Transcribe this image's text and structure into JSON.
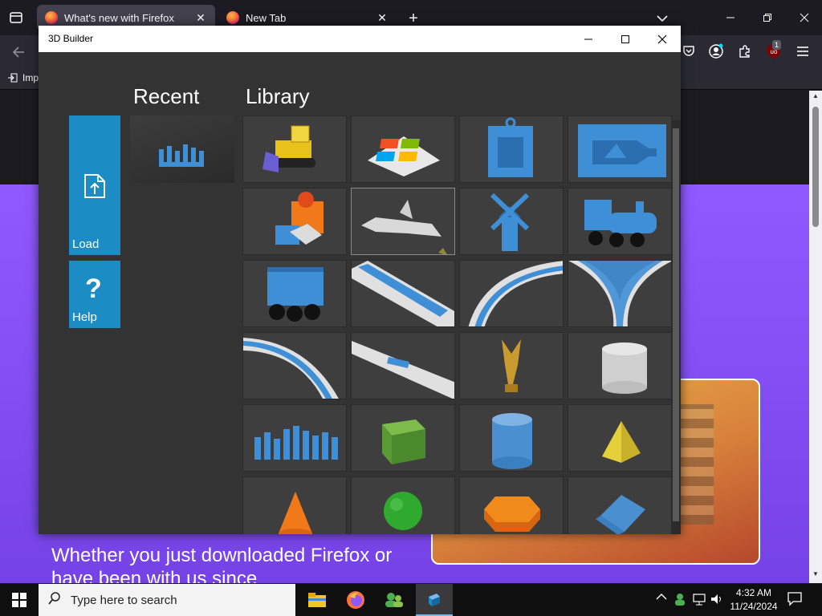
{
  "browser": {
    "tabs": [
      {
        "title": "What's new with Firefox",
        "active": true
      },
      {
        "title": "New Tab",
        "active": false
      }
    ],
    "bookmark_label": "Imp",
    "ublock_badge": "1"
  },
  "page": {
    "hero_title": "Whether you just downloaded Firefox or have been with us since",
    "accent": "#9059ff"
  },
  "app": {
    "title": "3D Builder",
    "recent_heading": "Recent",
    "library_heading": "Library",
    "load_label": "Load",
    "help_label": "Help",
    "help_glyph": "?",
    "library_items": [
      "bulldozer",
      "color-tray",
      "picture-frame-pendant",
      "ship-in-bottle",
      "gift-box",
      "space-shuttle",
      "windmill",
      "toy-train-engine",
      "toy-train-car",
      "straight-track-diagonal",
      "curved-track",
      "y-switch-track",
      "curved-track-2",
      "straight-track",
      "trophy",
      "cylinder-box",
      "chess-set",
      "cube",
      "cylinder",
      "pyramid",
      "cone",
      "sphere",
      "hexagonal-prism",
      "triangular-prism"
    ],
    "colors": {
      "tile_blue": "#1b8dc4",
      "model_blue": "#3f8fd6",
      "body": "#333333"
    }
  },
  "taskbar": {
    "search_placeholder": "Type here to search",
    "time": "4:32 AM",
    "date": "11/24/2024"
  }
}
